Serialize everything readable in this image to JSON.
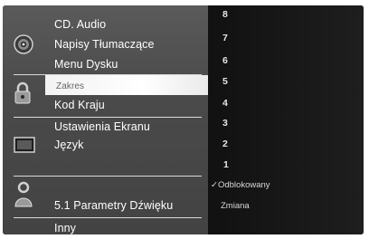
{
  "menu": {
    "items": [
      {
        "label": "CD. Audio"
      },
      {
        "label": "Napisy Tłumaczące"
      },
      {
        "label": "Menu Dysku"
      },
      {
        "label": "Zakres"
      },
      {
        "label": "Kod Kraju"
      },
      {
        "label": "Ustawienia Ekranu"
      },
      {
        "label": "Język"
      },
      {
        "label": "5.1 Parametry Dźwięku"
      },
      {
        "label": "Inny"
      }
    ],
    "icons": [
      "disc-icon",
      "padlock-icon",
      "screen-icon",
      "speaker-person-icon"
    ],
    "highlight_color": "#ffffff"
  },
  "rating_options": {
    "levels": [
      "8",
      "7",
      "6",
      "5",
      "4",
      "3",
      "2",
      "1"
    ],
    "selected_mark": "✓",
    "unlocked": "Odblokowany",
    "change": "Zmiana"
  }
}
